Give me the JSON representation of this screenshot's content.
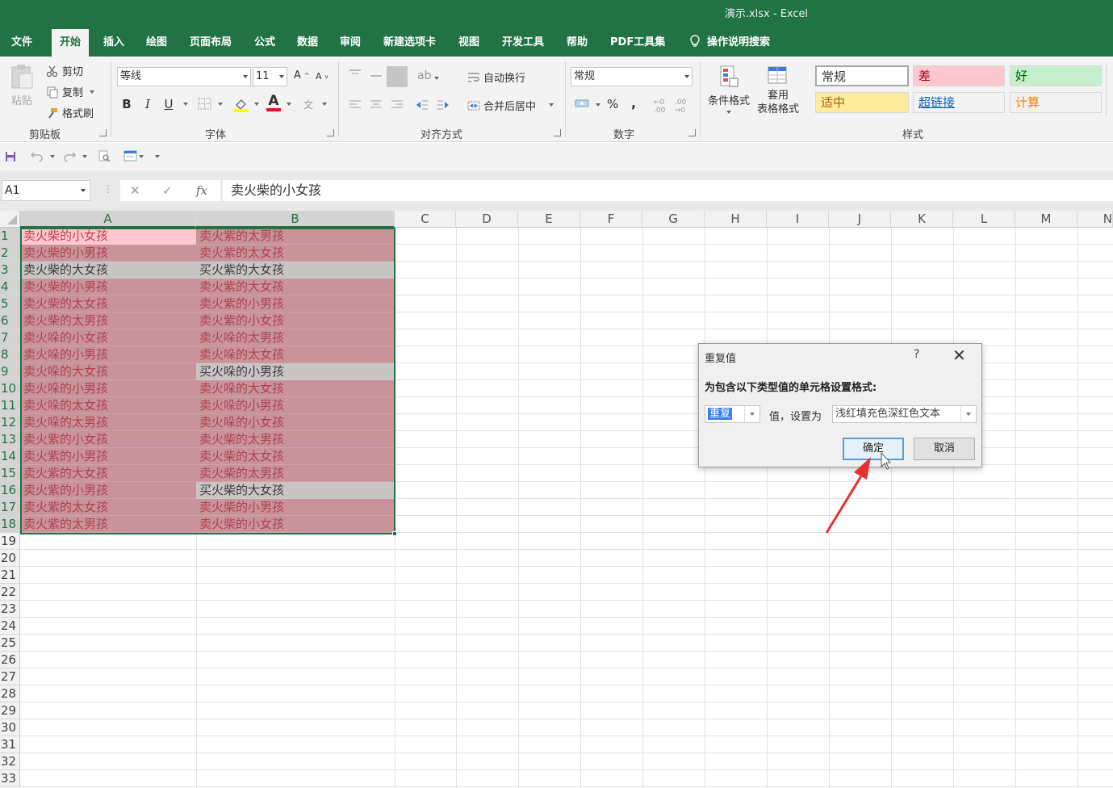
{
  "window": {
    "title": "演示.xlsx  -  Excel"
  },
  "ribbon_tabs": [
    "文件",
    "开始",
    "插入",
    "绘图",
    "页面布局",
    "公式",
    "数据",
    "审阅",
    "新建选项卡",
    "视图",
    "开发工具",
    "帮助",
    "PDF工具集"
  ],
  "tell_me": "操作说明搜索",
  "clipboard": {
    "paste": "粘贴",
    "cut": "剪切",
    "copy": "复制",
    "format_painter": "格式刷",
    "group": "剪贴板"
  },
  "font": {
    "name": "等线",
    "size": "11",
    "group": "字体",
    "bold": "B",
    "italic": "I",
    "underline": "U",
    "grow": "A",
    "shrink": "A",
    "font_color": "A",
    "phonetic": "文"
  },
  "alignment": {
    "wrap": "自动换行",
    "merge": "合并后居中",
    "group": "对齐方式"
  },
  "number": {
    "format": "常规",
    "percent": "%",
    "comma": ",",
    "group": "数字"
  },
  "styles": {
    "conditional": "条件格式",
    "table_line1": "套用",
    "table_line2": "表格格式",
    "group": "样式",
    "cells": [
      {
        "label": "常规",
        "bg": "#ffffff",
        "color": "#333333"
      },
      {
        "label": "差",
        "bg": "#ffc7ce",
        "color": "#9c0006"
      },
      {
        "label": "好",
        "bg": "#c6efce",
        "color": "#006100"
      },
      {
        "label": "适中",
        "bg": "#ffeb9c",
        "color": "#9c6500"
      },
      {
        "label": "超链接",
        "bg": "#f3f3f3",
        "color": "#0563c1"
      },
      {
        "label": "计算",
        "bg": "#f2f2f2",
        "color": "#fa7d00"
      }
    ]
  },
  "formula_bar": {
    "name_box": "A1",
    "cancel": "✕",
    "enter": "✓",
    "fx": "fx",
    "content": "卖火柴的小女孩"
  },
  "columns": [
    "A",
    "B",
    "C",
    "D",
    "E",
    "F",
    "G",
    "H",
    "I",
    "J",
    "K",
    "L",
    "M",
    "N"
  ],
  "rows": [
    "1",
    "2",
    "3",
    "4",
    "5",
    "6",
    "7",
    "8",
    "9",
    "10",
    "11",
    "12",
    "13",
    "14",
    "15",
    "16",
    "17",
    "18",
    "19",
    "20",
    "21",
    "22",
    "23",
    "24",
    "25",
    "26",
    "27",
    "28",
    "29",
    "30",
    "31",
    "32",
    "33"
  ],
  "cells": [
    {
      "a": "卖火柴的小女孩",
      "b": "卖火紫的太男孩",
      "a_state": "active",
      "b_state": "dup"
    },
    {
      "a": "卖火柴的小男孩",
      "b": "卖火紫的太女孩",
      "a_state": "dup",
      "b_state": "dup"
    },
    {
      "a": "卖火柴的大女孩",
      "b": "买火紫的大女孩",
      "a_state": "uniq",
      "b_state": "uniq"
    },
    {
      "a": "卖火柴的小男孩",
      "b": "卖火紫的大女孩",
      "a_state": "dup",
      "b_state": "dup"
    },
    {
      "a": "卖火柴的太女孩",
      "b": "卖火紫的小男孩",
      "a_state": "dup",
      "b_state": "dup"
    },
    {
      "a": "卖火柴的太男孩",
      "b": "卖火紫的小女孩",
      "a_state": "dup",
      "b_state": "dup"
    },
    {
      "a": "卖火哚的小女孩",
      "b": "卖火哚的太男孩",
      "a_state": "dup",
      "b_state": "dup"
    },
    {
      "a": "卖火哚的小男孩",
      "b": "卖火哚的太女孩",
      "a_state": "dup",
      "b_state": "dup"
    },
    {
      "a": "卖火哚的大女孩",
      "b": "买火哚的小男孩",
      "a_state": "dup",
      "b_state": "uniq"
    },
    {
      "a": "卖火哚的小男孩",
      "b": "卖火哚的大女孩",
      "a_state": "dup",
      "b_state": "dup"
    },
    {
      "a": "卖火哚的太女孩",
      "b": "卖火哚的小男孩",
      "a_state": "dup",
      "b_state": "dup"
    },
    {
      "a": "卖火哚的太男孩",
      "b": "卖火哚的小女孩",
      "a_state": "dup",
      "b_state": "dup"
    },
    {
      "a": "卖火紫的小女孩",
      "b": "卖火柴的太男孩",
      "a_state": "dup",
      "b_state": "dup"
    },
    {
      "a": "卖火紫的小男孩",
      "b": "卖火柴的太女孩",
      "a_state": "dup",
      "b_state": "dup"
    },
    {
      "a": "卖火紫的大女孩",
      "b": "卖火柴的太男孩",
      "a_state": "dup",
      "b_state": "dup"
    },
    {
      "a": "卖火紫的小男孩",
      "b": "买火柴的大女孩",
      "a_state": "dup",
      "b_state": "uniq"
    },
    {
      "a": "卖火紫的太女孩",
      "b": "卖火柴的小男孩",
      "a_state": "dup",
      "b_state": "dup"
    },
    {
      "a": "卖火紫的太男孩",
      "b": "卖火柴的小女孩",
      "a_state": "dup",
      "b_state": "dup"
    }
  ],
  "dialog": {
    "title": "重复值",
    "help": "?",
    "close": "✕",
    "prompt": "为包含以下类型值的单元格设置格式:",
    "type_value": "重复",
    "mid_text": "值，设置为",
    "format_value": "浅红填充色深红色文本",
    "ok": "确定",
    "cancel": "取消"
  },
  "colors": {
    "excel_green": "#217346",
    "dup_fill": "#c8939b",
    "dup_text": "#b0414f",
    "annotation_arrow": "#e8312f"
  }
}
